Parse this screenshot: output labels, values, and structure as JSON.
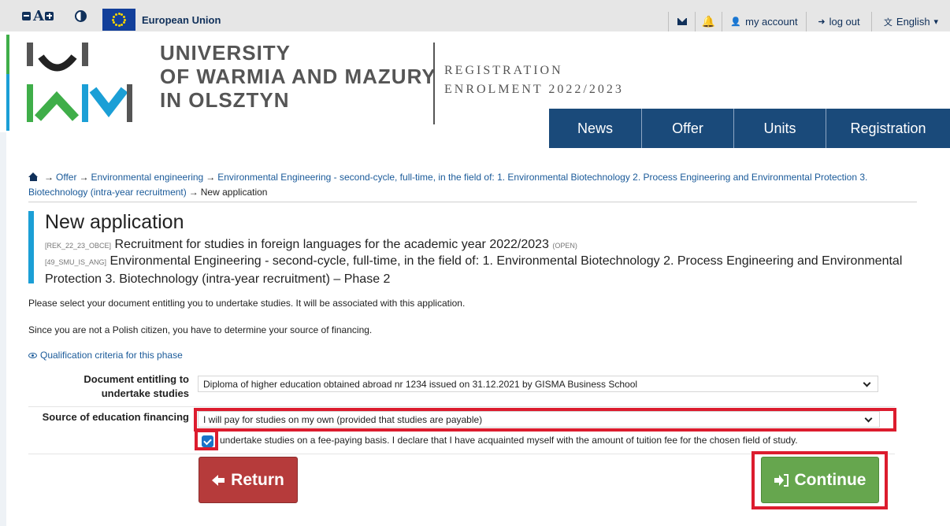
{
  "topbar": {
    "accessibility": {
      "font_label": "A"
    },
    "eu_label": "European Union",
    "account_label": "my account",
    "logout_label": "log out",
    "language_label": "English"
  },
  "header": {
    "university_lines": [
      "UNIVERSITY",
      "OF WARMIA AND MAZURY",
      "IN OLSZTYN"
    ],
    "registration_title": "REGISTRATION",
    "enrolment_title": "ENROLMENT 2022/2023",
    "nav": [
      "News",
      "Offer",
      "Units",
      "Registration"
    ]
  },
  "breadcrumb": {
    "items": [
      "Offer",
      "Environmental engineering",
      "Environmental Engineering - second-cycle, full-time, in the field of: 1. Environmental Biotechnology 2. Process Engineering and Environmental Protection 3. Biotechnology (intra-year recruitment)"
    ],
    "current": "New application",
    "separator": "→"
  },
  "page": {
    "title": "New application",
    "recruitment_code": "[REK_22_23_OBCE]",
    "recruitment_name": "Recruitment for studies in foreign languages for the academic year 2022/2023",
    "recruitment_status": "(open)",
    "program_code": "[49_SMU_IS_ANG]",
    "program_name": "Environmental Engineering - second-cycle, full-time, in the field of: 1. Environmental Biotechnology 2. Process Engineering and Environmental Protection 3. Biotechnology (intra-year recruitment) – Phase 2",
    "info_document": "Please select your document entitling you to undertake studies. It will be associated with this application.",
    "info_financing": "Since you are not a Polish citizen, you have to determine your source of financing.",
    "criteria_link": "Qualification criteria for this phase"
  },
  "form": {
    "document_label": "Document entitling to undertake studies",
    "document_value": "Diploma of higher education obtained abroad nr 1234 issued on 31.12.2021 by GISMA Business School",
    "financing_label": "Source of education financing",
    "financing_value": "I will pay for studies on my own (provided that studies are payable)",
    "declaration_checked": true,
    "declaration_text": "undertake studies on a fee-paying basis. I declare that I have acquainted myself with the amount of tuition fee for the chosen field of study.",
    "return_label": "Return",
    "continue_label": "Continue"
  },
  "colors": {
    "nav_bg": "#1a4a7a",
    "highlight": "#dc1c2e",
    "return_bg": "#b63b3b",
    "continue_bg": "#66a64e",
    "accent_blue": "#1b9fd6",
    "accent_green": "#3fae49"
  },
  "icons": [
    "contrast-icon",
    "eu-flag-icon",
    "envelope-icon",
    "bell-icon",
    "user-icon",
    "sign-out-icon",
    "translate-icon",
    "chevron-down-icon",
    "home-icon",
    "eye-icon",
    "arrow-left-icon",
    "sign-in-icon"
  ]
}
